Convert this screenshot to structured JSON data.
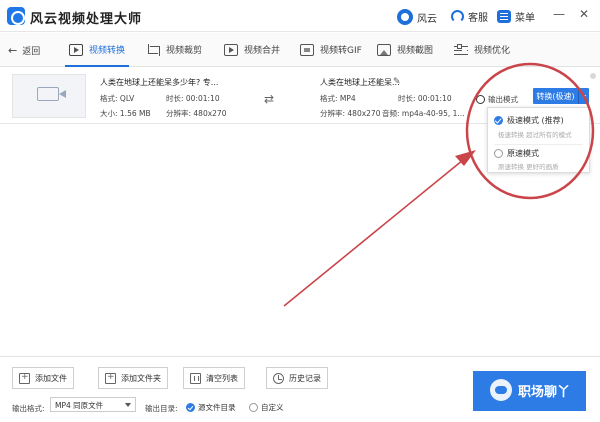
{
  "app": {
    "title": "风云视频处理大师"
  },
  "titlebar": {
    "fengyun": "风云",
    "service": "客服",
    "menu": "菜单",
    "minimize": "—",
    "close": "✕"
  },
  "toolbar": {
    "back": "返回",
    "tabs": [
      {
        "label": "视频转换",
        "icon": "play-icon",
        "active": true
      },
      {
        "label": "视频裁剪",
        "icon": "crop-icon"
      },
      {
        "label": "视频合并",
        "icon": "merge-icon"
      },
      {
        "label": "视频转GIF",
        "icon": "gif-icon"
      },
      {
        "label": "视频截图",
        "icon": "screenshot-icon"
      },
      {
        "label": "视频优化",
        "icon": "adjust-icon"
      }
    ]
  },
  "file": {
    "src": {
      "name": "人类在地球上还能呆多少年? 专...",
      "format_label": "格式: QLV",
      "duration_label": "时长: 00:01:10",
      "size_label": "大小: 1.56 MB",
      "resolution_label": "分辨率: 480x270"
    },
    "out": {
      "name": "人类在地球上还能呆...",
      "format_label": "格式: MP4",
      "duration_label": "时长: 00:01:10",
      "resolution_label": "分辨率: 480x270",
      "audio_label": "音频: mp4a-40-95, 1..."
    },
    "mode_label": "输出模式",
    "convert_btn": "转换(极速)"
  },
  "dropdown": {
    "items": [
      {
        "title": "极速模式 (推荐)",
        "desc": "极速转换 超过所有的模式",
        "selected": true
      },
      {
        "title": "原速模式",
        "desc": "原速转换 更好的画质",
        "selected": false
      }
    ]
  },
  "bottom": {
    "buttons": [
      "添加文件",
      "添加文件夹",
      "清空列表",
      "历史记录"
    ],
    "format_label": "输出格式:",
    "format_value": "MP4 同原文件",
    "dir_label": "输出目录:",
    "dir_options": [
      {
        "label": "源文件目录",
        "selected": true
      },
      {
        "label": "自定义",
        "selected": false
      }
    ],
    "watermark": "职场聊丫"
  },
  "colors": {
    "accent": "#2d7be5",
    "annotation": "#c9454a"
  }
}
